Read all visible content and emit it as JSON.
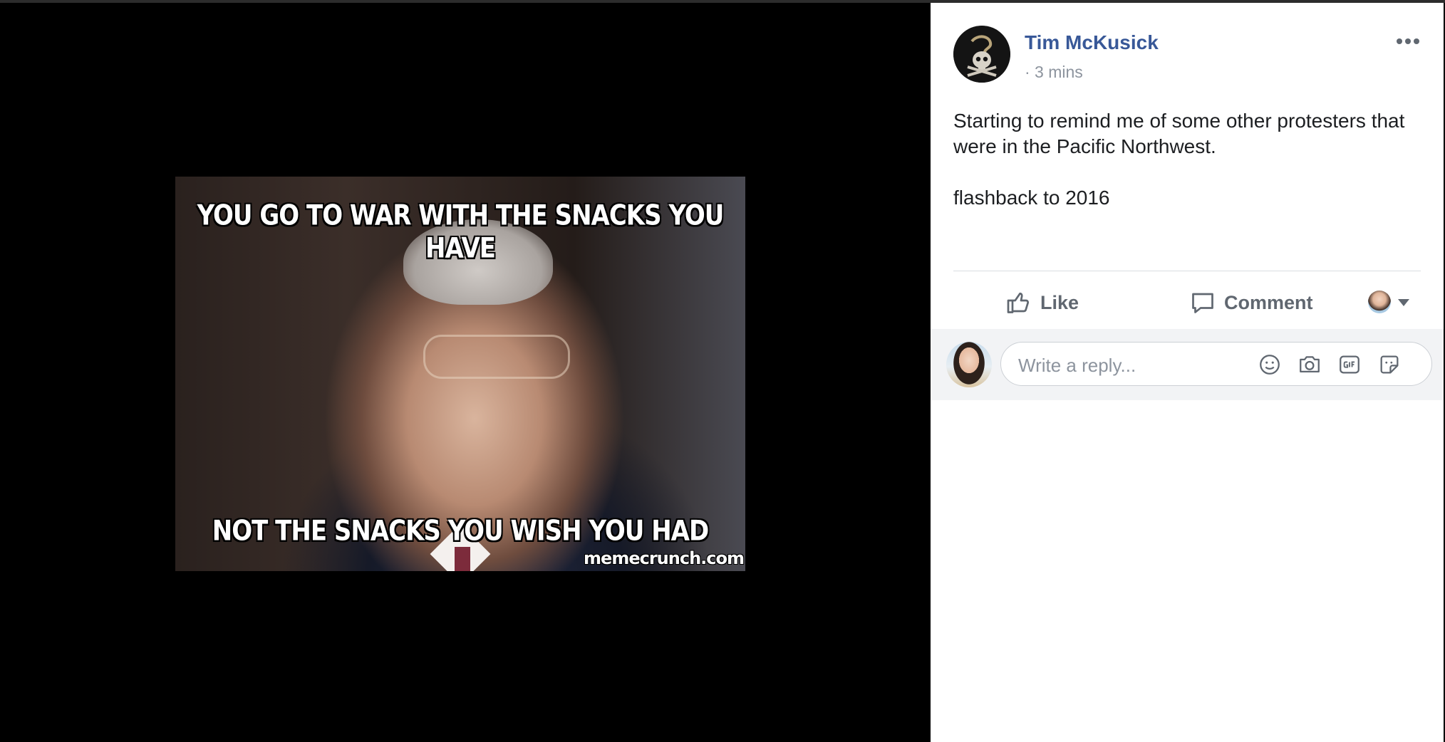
{
  "meme": {
    "top_text": "YOU GO TO WAR WITH THE SNACKS YOU HAVE",
    "bottom_text": "NOT THE SNACKS YOU WISH YOU HAD",
    "watermark": "memecrunch.com"
  },
  "post": {
    "author": "Tim McKusick",
    "timestamp": "· 3 mins",
    "text_line1": "Starting to remind me of some other protesters that were in the Pacific Northwest.",
    "text_line2": "flashback to 2016"
  },
  "actions": {
    "like_label": "Like",
    "comment_label": "Comment"
  },
  "reply": {
    "placeholder": "Write a reply..."
  },
  "icons": {
    "more": "more-options-icon",
    "like": "thumbs-up-icon",
    "comment": "comment-bubble-icon",
    "emoji": "emoji-icon",
    "camera": "camera-icon",
    "gif": "gif-icon",
    "sticker": "sticker-icon"
  },
  "colors": {
    "link": "#385898",
    "muted": "#606770",
    "meta": "#8d949e",
    "reply_bg": "#f2f3f5"
  }
}
